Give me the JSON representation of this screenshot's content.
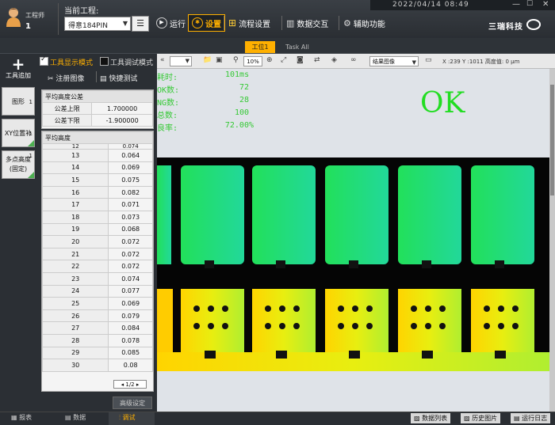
{
  "header": {
    "user_role": "工程师",
    "user_number": "1",
    "project_label": "当前工程:",
    "project_value": "得意184PIN",
    "nav": {
      "run": "运行",
      "setting": "设置",
      "flow": "流程设置",
      "data_exchange": "数据交互",
      "aux": "辅助功能"
    },
    "datetime": "2022/04/14  08:49",
    "logo": "三瑞科技"
  },
  "tabs": {
    "station": "工位1",
    "all": "Task All"
  },
  "left_toolbar": {
    "add_tool": "工具追加",
    "cards": [
      {
        "label": "图形",
        "num": "1"
      },
      {
        "label": "XY位置补正",
        "num": "1"
      },
      {
        "label": "多点高度(固定)",
        "num": "1"
      }
    ]
  },
  "tool_panel": {
    "mode_show": "工具显示模式",
    "mode_debug": "工具调试模式",
    "register_image": "注册图像",
    "quick_test": "快捷测试",
    "tolerance": {
      "title": "平均高度公差",
      "rows": [
        {
          "label": "公差上限",
          "value": "1.700000"
        },
        {
          "label": "公差下限",
          "value": "-1.900000"
        }
      ]
    },
    "avg_height": {
      "title": "平均高度",
      "first_partial": {
        "index": "12",
        "value": "0.074"
      },
      "rows": [
        {
          "index": "13",
          "value": "0.064"
        },
        {
          "index": "14",
          "value": "0.069"
        },
        {
          "index": "15",
          "value": "0.075"
        },
        {
          "index": "16",
          "value": "0.082"
        },
        {
          "index": "17",
          "value": "0.071"
        },
        {
          "index": "18",
          "value": "0.073"
        },
        {
          "index": "19",
          "value": "0.068"
        },
        {
          "index": "20",
          "value": "0.072"
        },
        {
          "index": "21",
          "value": "0.072"
        },
        {
          "index": "22",
          "value": "0.072"
        },
        {
          "index": "23",
          "value": "0.074"
        },
        {
          "index": "24",
          "value": "0.077"
        },
        {
          "index": "25",
          "value": "0.069"
        },
        {
          "index": "26",
          "value": "0.079"
        },
        {
          "index": "27",
          "value": "0.084"
        },
        {
          "index": "28",
          "value": "0.078"
        },
        {
          "index": "29",
          "value": "0.085"
        },
        {
          "index": "30",
          "value": "0.08"
        }
      ]
    },
    "pager": "1/2",
    "advanced_button": "高级设定"
  },
  "image_toolbar": {
    "zoom": "10%",
    "result_select": "结果图像",
    "coords": "X :239 Y :1011 高度值: 0 μm"
  },
  "overlay_stats": [
    {
      "label": "耗时:",
      "value": "101ms"
    },
    {
      "label": "OK数:",
      "value": "72"
    },
    {
      "label": "NG数:",
      "value": "28"
    },
    {
      "label": "总数:",
      "value": "100"
    },
    {
      "label": "良率:",
      "value": "72.00%"
    }
  ],
  "overlay_result": "OK",
  "bottom": {
    "tabs": [
      "报表",
      "数据",
      "调试"
    ],
    "buttons": [
      "数据列表",
      "历史图片",
      "运行日志"
    ]
  },
  "colors": {
    "accent": "#ffb000",
    "ok_green": "#22dd22",
    "stat_green": "#36c936"
  }
}
